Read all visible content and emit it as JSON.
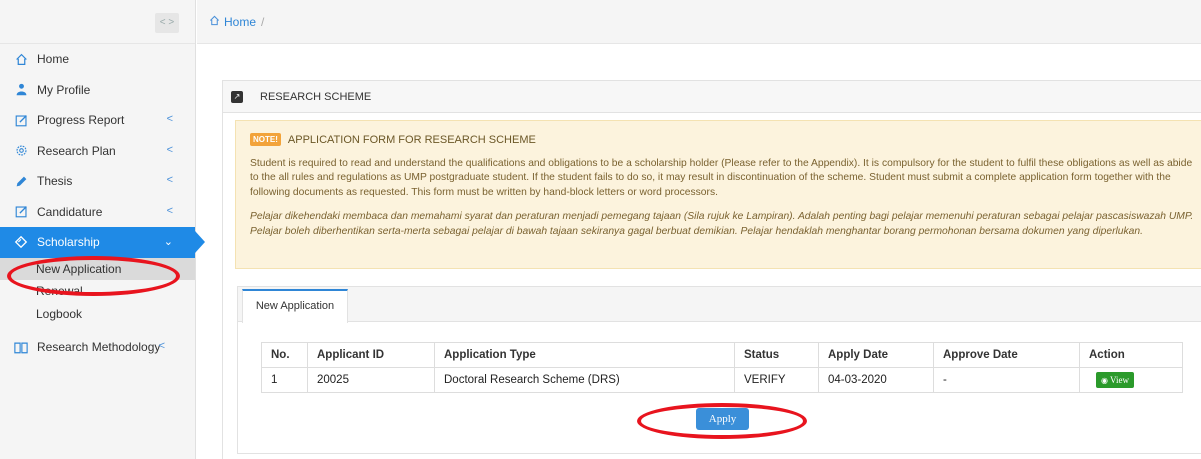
{
  "breadcrumb": {
    "home": "Home",
    "separator": "/"
  },
  "sidebar": {
    "toggle": "< >",
    "items": [
      {
        "label": "Home",
        "icon": "home-icon"
      },
      {
        "label": "My Profile",
        "icon": "user-icon"
      },
      {
        "label": "Progress Report",
        "icon": "edit-icon",
        "chevron": "<"
      },
      {
        "label": "Research Plan",
        "icon": "gear-icon",
        "chevron": "<"
      },
      {
        "label": "Thesis",
        "icon": "pencil-icon",
        "chevron": "<"
      },
      {
        "label": "Candidature",
        "icon": "edit-icon",
        "chevron": "<"
      },
      {
        "label": "Scholarship",
        "icon": "diamond-icon",
        "chevron": "⌄"
      },
      {
        "label": "Research Methodology",
        "icon": "book-icon",
        "chevron": "<"
      }
    ],
    "submenu": [
      "New Application",
      "Renewal",
      "Logbook"
    ]
  },
  "panel": {
    "title": "RESEARCH SCHEME",
    "note": {
      "badge": "NOTE!",
      "title": "APPLICATION FORM FOR RESEARCH SCHEME",
      "english": "Student is required to read and understand the qualifications and obligations to be a scholarship holder (Please refer to the Appendix). It is compulsory for the student to fulfil these obligations as well as abide to the all rules and regulations as UMP postgraduate student. If the student fails to do so, it may result in discontinuation of the scheme. Student must submit a complete application form together with the following documents as requested. This form must be written by hand-block letters or word processors.",
      "malay": "Pelajar dikehendaki membaca dan memahami syarat dan peraturan menjadi pemegang tajaan (Sila rujuk ke Lampiran). Adalah penting bagi pelajar memenuhi peraturan sebagai pelajar pascasiswazah UMP. Pelajar boleh diberhentikan serta-merta sebagai pelajar di bawah tajaan sekiranya gagal berbuat demikian. Pelajar hendaklah menghantar borang permohonan bersama dokumen yang diperlukan."
    },
    "tab": "New Application",
    "table": {
      "headers": [
        "No.",
        "Applicant ID",
        "Application Type",
        "Status",
        "Apply Date",
        "Approve Date",
        "Action"
      ],
      "rows": [
        {
          "no": "1",
          "applicant_id": "20025",
          "type": "Doctoral Research Scheme (DRS)",
          "status": "VERIFY",
          "apply_date": "04-03-2020",
          "approve_date": "-",
          "action": "View"
        }
      ]
    },
    "apply_label": "Apply"
  },
  "colors": {
    "accent": "#1f8ae6",
    "view_button": "#2b9a2b",
    "note_bg": "#fcf3dd",
    "annotation": "#e8141e"
  }
}
